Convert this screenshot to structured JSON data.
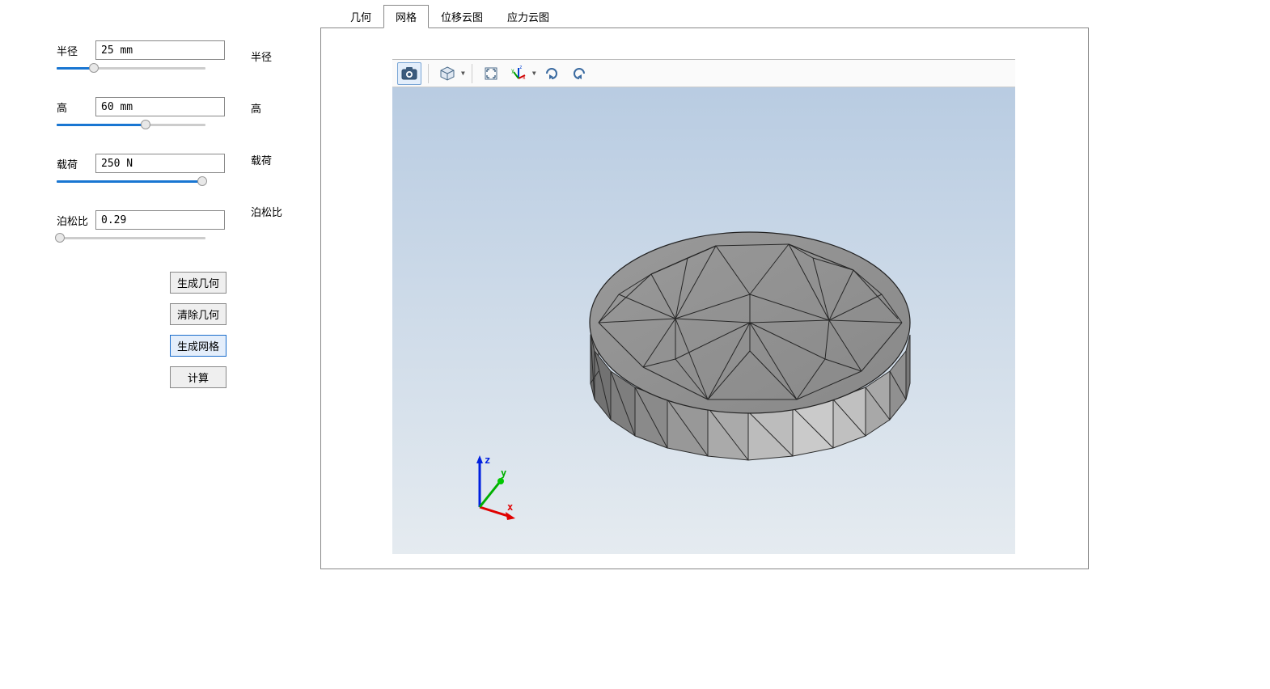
{
  "params": {
    "radius": {
      "label": "半径",
      "value": "25 mm",
      "slider_pct": 25
    },
    "height": {
      "label": "高",
      "value": "60 mm",
      "slider_pct": 60
    },
    "load": {
      "label": "载荷",
      "value": "250 N",
      "slider_pct": 98
    },
    "poisson": {
      "label": "泊松比",
      "value": "0.29",
      "slider_pct": 2
    }
  },
  "side_labels": {
    "radius": "半径",
    "height": "高",
    "load": "载荷",
    "poisson": "泊松比"
  },
  "buttons": {
    "gen_geom": "生成几何",
    "clear_geom": "清除几何",
    "gen_mesh": "生成网格",
    "calc": "计算"
  },
  "tabs": {
    "geometry": "几何",
    "mesh": "网格",
    "disp": "位移云图",
    "stress": "应力云图",
    "active": "mesh"
  },
  "toolbar": {
    "snapshot": "snapshot",
    "viewcube": "view-cube",
    "fit": "fit-view",
    "axes": "axes-toggle",
    "rotate_cw": "rotate-cw",
    "rotate_ccw": "rotate-ccw"
  },
  "gizmo": {
    "x": "x",
    "y": "y",
    "z": "z"
  }
}
